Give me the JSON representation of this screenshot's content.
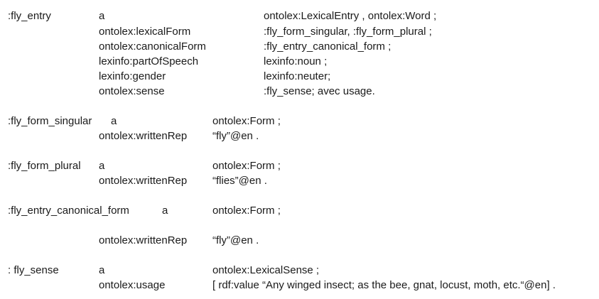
{
  "block1": {
    "subject": ":fly_entry",
    "rows": [
      {
        "pred": "a",
        "obj": "ontolex:LexicalEntry , ontolex:Word ;"
      },
      {
        "pred": "ontolex:lexicalForm",
        "obj": ":fly_form_singular, :fly_form_plural ;"
      },
      {
        "pred": "ontolex:canonicalForm",
        "obj": ":fly_entry_canonical_form ;"
      },
      {
        "pred": "lexinfo:partOfSpeech",
        "obj": "lexinfo:noun ;"
      },
      {
        "pred": "lexinfo:gender",
        "obj": "lexinfo:neuter;"
      },
      {
        "pred": "ontolex:sense",
        "obj": ":fly_sense; avec usage."
      }
    ]
  },
  "block2": {
    "subject": ":fly_form_singular",
    "rows": [
      {
        "pred": "a",
        "obj": "ontolex:Form ;"
      },
      {
        "pred": "ontolex:writtenRep",
        "obj": "“fly”@en ."
      }
    ]
  },
  "block3": {
    "subject": ":fly_form_plural",
    "rows": [
      {
        "pred": "a",
        "obj": "ontolex:Form ;"
      },
      {
        "pred": "ontolex:writtenRep",
        "obj": "“flies”@en ."
      }
    ]
  },
  "block4": {
    "subject": ":fly_entry_canonical_form",
    "rows": [
      {
        "pred": "a",
        "obj": "ontolex:Form ;"
      },
      {
        "pred": "ontolex:writtenRep",
        "obj": "“fly”@en ."
      }
    ]
  },
  "block5": {
    "subject": ": fly_sense",
    "rows": [
      {
        "pred": "a",
        "obj": "ontolex:LexicalSense ;"
      },
      {
        "pred": "ontolex:usage",
        "obj": "[ rdf:value “Any winged insect; as the bee, gnat, locust, moth, etc.“@en] ."
      }
    ]
  }
}
